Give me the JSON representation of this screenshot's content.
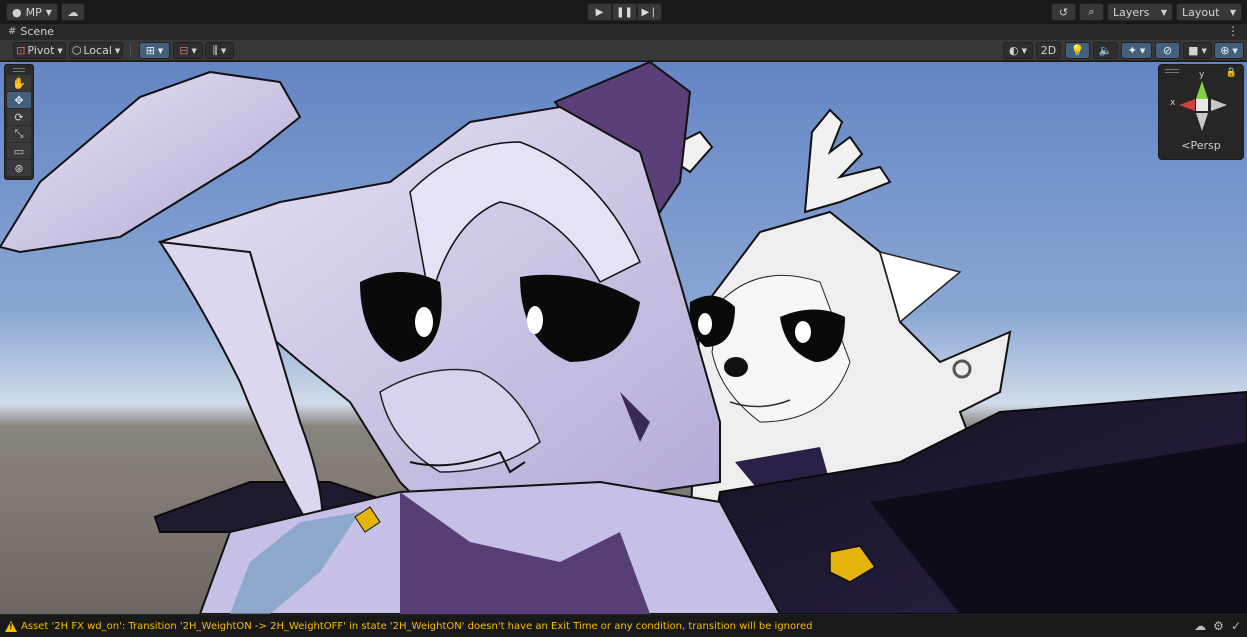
{
  "top_toolbar": {
    "account_label": "MP",
    "layers_label": "Layers",
    "layout_label": "Layout",
    "play_icon": "play-icon",
    "pause_icon": "pause-icon",
    "step_icon": "step-icon"
  },
  "tab": {
    "scene_label": "Scene"
  },
  "scene_toolbar": {
    "pivot_label": "Pivot",
    "local_label": "Local",
    "mode_2d_label": "2D"
  },
  "gizmo": {
    "persp_label": "<Persp",
    "x_label": "x",
    "y_label": "y"
  },
  "status": {
    "message": "Asset '2H FX wd_on': Transition '2H_WeightON -> 2H_WeightOFF' in state '2H_WeightON' doesn't have an Exit Time or any condition, transition will be ignored"
  },
  "colors": {
    "accent": "#46607c",
    "warning": "#f4bc02",
    "sky_top": "#6f8dc7",
    "sky_horizon": "#cfdbe8",
    "ground": "#6e6661"
  }
}
